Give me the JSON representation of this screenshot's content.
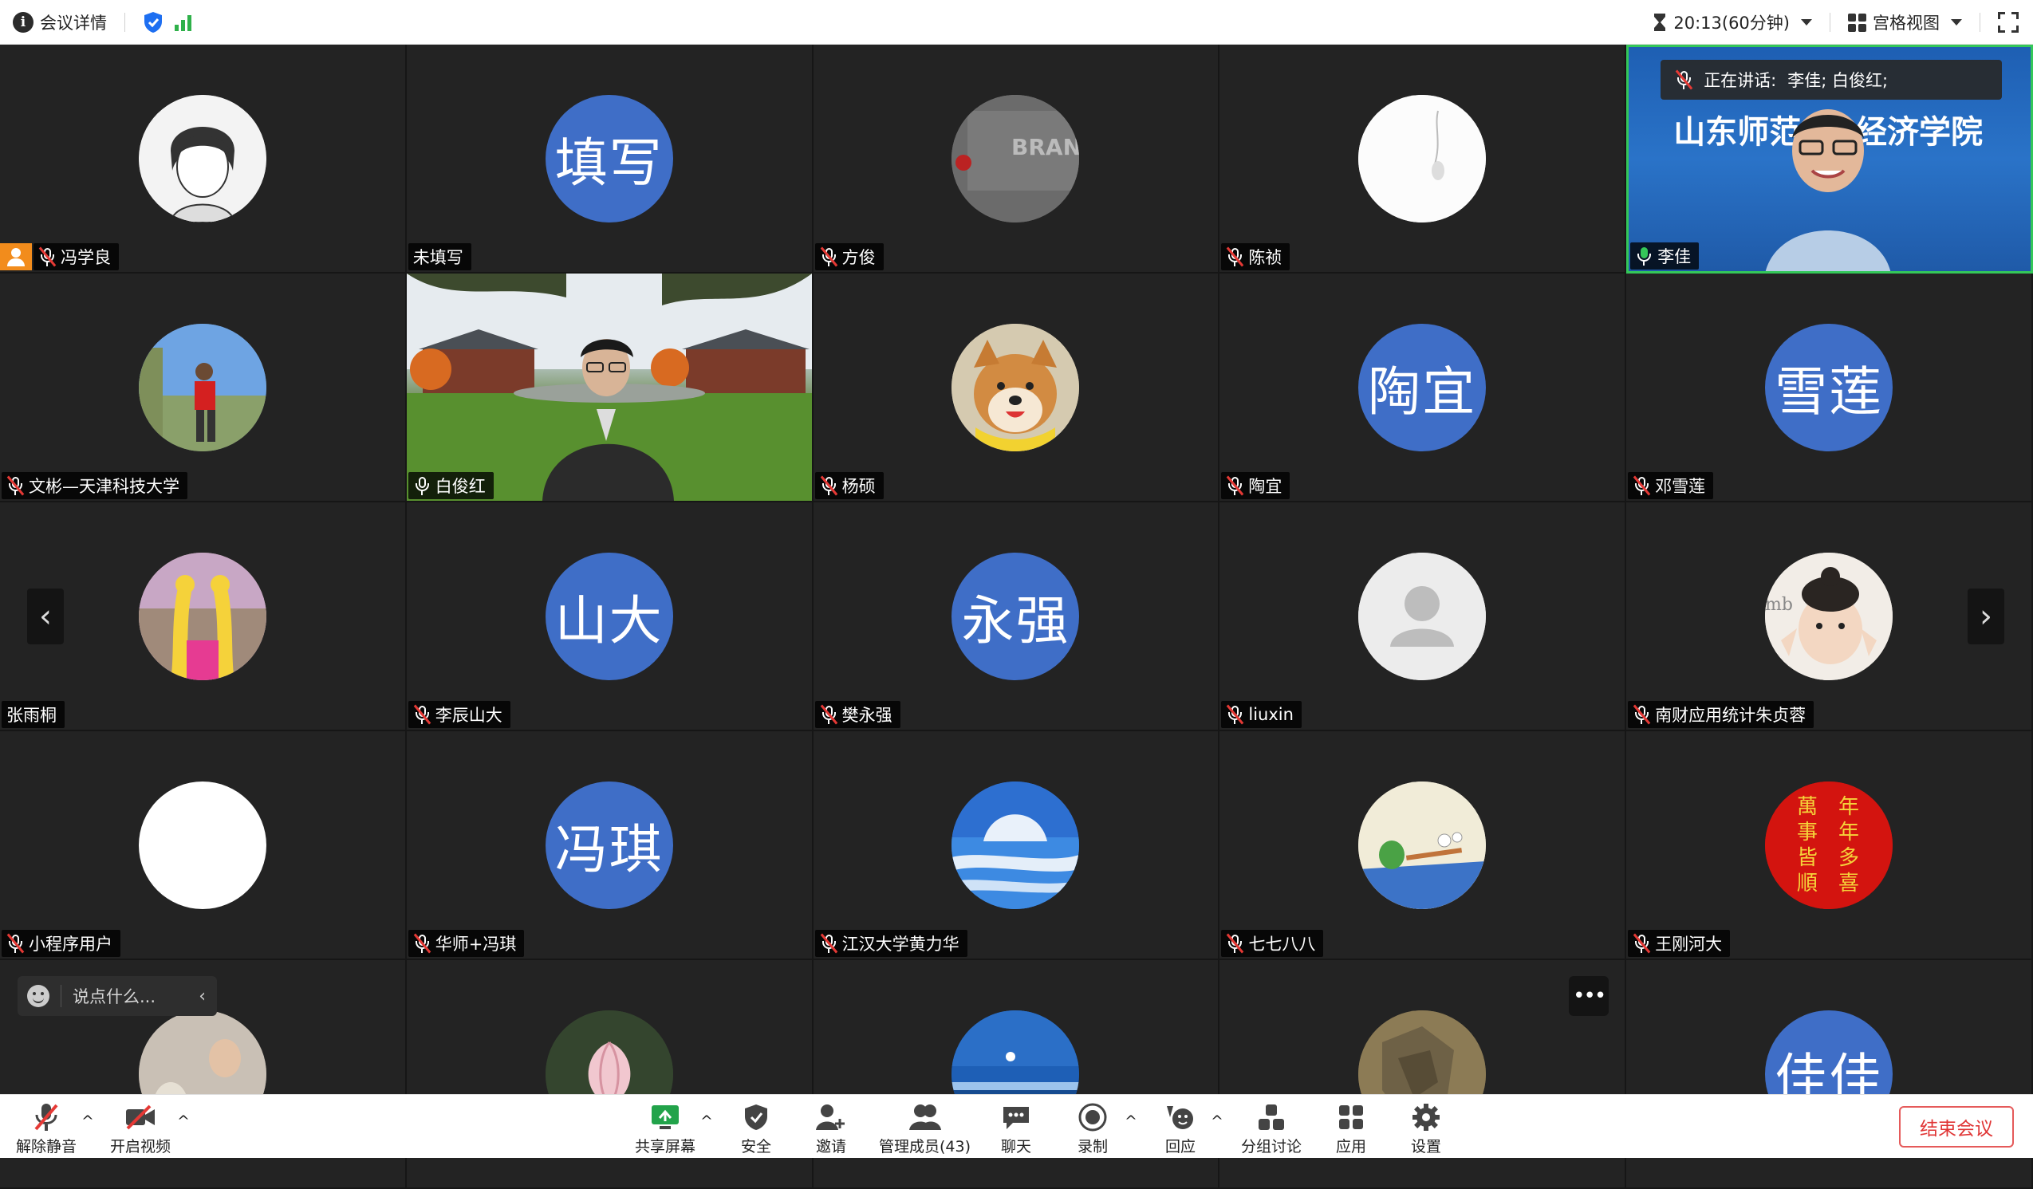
{
  "topbar": {
    "meeting_info": "会议详情",
    "timer": "20:13(60分钟)",
    "view_mode": "宫格视图"
  },
  "speaking": {
    "label": "正在讲话:",
    "names": "李佳; 白俊红;"
  },
  "speaker_background_text": {
    "left": "山东师范",
    "right": "经济学院"
  },
  "participants": [
    {
      "name": "冯学良",
      "avatar_text": "",
      "muted": true,
      "host": true
    },
    {
      "name": "未填写",
      "avatar_text": "填写",
      "muted": false
    },
    {
      "name": "方俊",
      "avatar_text": "",
      "muted": true
    },
    {
      "name": "陈祯",
      "avatar_text": "",
      "muted": true
    },
    {
      "name": "李佳",
      "avatar_text": "",
      "muted": false,
      "video": true
    },
    {
      "name": "文彬—天津科技大学",
      "avatar_text": "",
      "muted": true
    },
    {
      "name": "白俊红",
      "avatar_text": "",
      "muted": false,
      "video": true
    },
    {
      "name": "杨硕",
      "avatar_text": "",
      "muted": true
    },
    {
      "name": "陶宜",
      "avatar_text": "陶宜",
      "muted": true
    },
    {
      "name": "邓雪莲",
      "avatar_text": "雪莲",
      "muted": true
    },
    {
      "name": "张雨桐",
      "avatar_text": "",
      "muted": false
    },
    {
      "name": "李辰山大",
      "avatar_text": "山大",
      "muted": true
    },
    {
      "name": "樊永强",
      "avatar_text": "永强",
      "muted": true
    },
    {
      "name": "liuxin",
      "avatar_text": "",
      "muted": true
    },
    {
      "name": "南财应用统计朱贞蓉",
      "avatar_text": "",
      "muted": true
    },
    {
      "name": "小程序用户",
      "avatar_text": "",
      "muted": true
    },
    {
      "name": "华师+冯琪",
      "avatar_text": "冯琪",
      "muted": true
    },
    {
      "name": "江汉大学黄力华",
      "avatar_text": "",
      "muted": true
    },
    {
      "name": "七七八八",
      "avatar_text": "",
      "muted": true
    },
    {
      "name": "王刚河大",
      "avatar_text": "",
      "muted": true
    },
    {
      "name": "",
      "avatar_text": ""
    },
    {
      "name": "",
      "avatar_text": ""
    },
    {
      "name": "",
      "avatar_text": ""
    },
    {
      "name": "",
      "avatar_text": ""
    },
    {
      "name": "",
      "avatar_text": "佳佳"
    }
  ],
  "chat_box": {
    "placeholder": "说点什么..."
  },
  "toolbar": {
    "unmute": "解除静音",
    "start_video": "开启视频",
    "share_screen": "共享屏幕",
    "security": "安全",
    "invite": "邀请",
    "manage_members": "管理成员(43)",
    "chat": "聊天",
    "record": "录制",
    "reactions": "回应",
    "breakout": "分组讨论",
    "apps": "应用",
    "settings": "设置",
    "end_meeting": "结束会议"
  },
  "colors": {
    "avatar_blue": "#3f6ec7",
    "speaking_border": "#34c759",
    "host_orange": "#f28c1c",
    "end_red": "#e03535"
  }
}
